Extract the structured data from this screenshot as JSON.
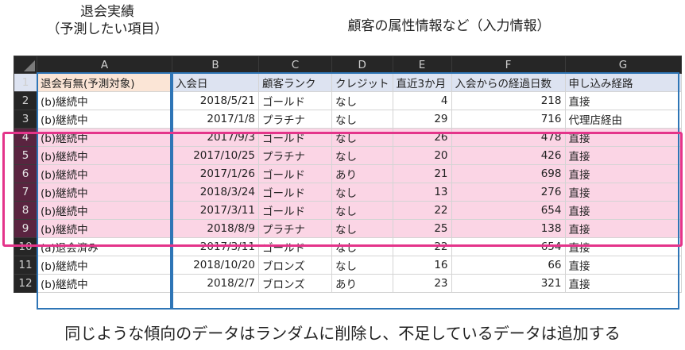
{
  "labels": {
    "left_line1": "退会実績",
    "left_line2": "（予測したい項目）",
    "right": "顧客の属性情報など（入力情報）"
  },
  "columns": [
    "A",
    "B",
    "C",
    "D",
    "E",
    "F",
    "G"
  ],
  "header_row": {
    "num": "1",
    "cells": [
      "退会有無(予測対象)",
      "入会日",
      "顧客ランク",
      "クレジット",
      "直近3か月",
      "入会からの経過日数",
      "申し込み経路"
    ]
  },
  "rows": [
    {
      "num": "2",
      "a": "(b)継続中",
      "b": "2018/5/21",
      "c": "ゴールド",
      "d": "なし",
      "e": "4",
      "f": "218",
      "g": "直接",
      "highlight": false
    },
    {
      "num": "3",
      "a": "(b)継続中",
      "b": "2017/1/8",
      "c": "プラチナ",
      "d": "なし",
      "e": "29",
      "f": "716",
      "g": "代理店経由",
      "highlight": false
    },
    {
      "num": "4",
      "a": "(b)継続中",
      "b": "2017/9/3",
      "c": "ゴールド",
      "d": "なし",
      "e": "26",
      "f": "478",
      "g": "直接",
      "highlight": true
    },
    {
      "num": "5",
      "a": "(b)継続中",
      "b": "2017/10/25",
      "c": "プラチナ",
      "d": "なし",
      "e": "20",
      "f": "426",
      "g": "直接",
      "highlight": true
    },
    {
      "num": "6",
      "a": "(b)継続中",
      "b": "2017/1/26",
      "c": "ゴールド",
      "d": "あり",
      "e": "21",
      "f": "698",
      "g": "直接",
      "highlight": true
    },
    {
      "num": "7",
      "a": "(b)継続中",
      "b": "2018/3/24",
      "c": "ゴールド",
      "d": "なし",
      "e": "13",
      "f": "276",
      "g": "直接",
      "highlight": true
    },
    {
      "num": "8",
      "a": "(b)継続中",
      "b": "2017/3/11",
      "c": "ゴールド",
      "d": "なし",
      "e": "22",
      "f": "654",
      "g": "直接",
      "highlight": true
    },
    {
      "num": "9",
      "a": "(b)継続中",
      "b": "2018/8/9",
      "c": "プラチナ",
      "d": "なし",
      "e": "25",
      "f": "138",
      "g": "直接",
      "highlight": true
    },
    {
      "num": "10",
      "a": "(a)退会済み",
      "b": "2017/3/11",
      "c": "ゴールド",
      "d": "なし",
      "e": "22",
      "f": "654",
      "g": "直接",
      "highlight": false
    },
    {
      "num": "11",
      "a": "(b)継続中",
      "b": "2018/10/20",
      "c": "ブロンズ",
      "d": "なし",
      "e": "16",
      "f": "66",
      "g": "直接",
      "highlight": false
    },
    {
      "num": "12",
      "a": "(b)継続中",
      "b": "2018/2/7",
      "c": "ブロンズ",
      "d": "あり",
      "e": "23",
      "f": "321",
      "g": "直接",
      "highlight": false
    }
  ],
  "caption": "同じような傾向のデータはランダムに削除し、不足しているデータは追加する",
  "colors": {
    "highlight_border": "#e4348a",
    "group_border": "#2e75b6",
    "highlight_fill": "#fbd5e5"
  }
}
